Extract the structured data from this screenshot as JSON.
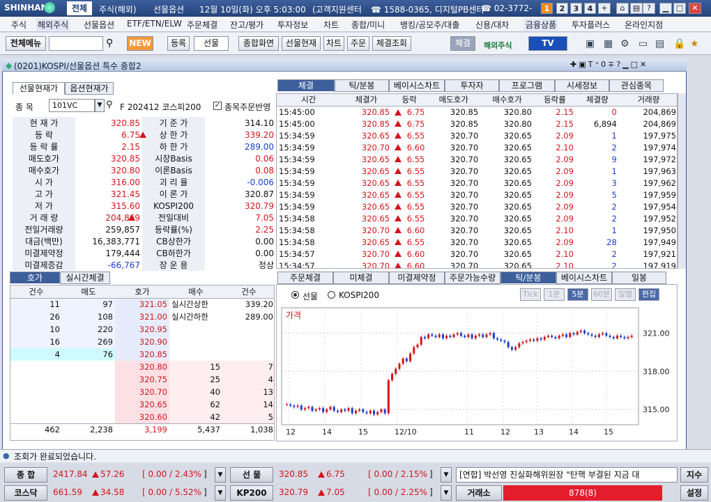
{
  "top": {
    "brand": "SHINHAN",
    "active_tab": "전체",
    "items": [
      "주식(해외)",
      "선물옵션",
      "12월 10일(화) 오후 5:03:00",
      "(고객지원센터",
      "☎ 1588-0365, 디지털PB센터",
      "☎ 02-3772-"
    ],
    "win_nums": [
      "1",
      "2",
      "3",
      "4"
    ]
  },
  "menu": [
    "주식",
    "해외주식",
    "선물옵션",
    "ETF/ETN/ELW",
    "주문체결",
    "잔고/평가",
    "투자정보",
    "차트",
    "종합/미니",
    "뱅킹/공모주/대출",
    "신용/대차",
    "금융상품",
    "투자플러스",
    "온라인지점"
  ],
  "toolbar": {
    "all_menu": "전체메뉴",
    "new": "NEW",
    "reg": "등록",
    "select": "선물",
    "buttons": [
      "종합화면",
      "선물현재",
      "차트",
      "주문",
      "체결조회"
    ],
    "cheg": "체결",
    "overseas": "해외주식",
    "tv": "TV"
  },
  "window": {
    "title": "(0201)KOSPI/선물옵션 특수 종합2"
  },
  "left": {
    "tabs": [
      "선물현재가",
      "옵션현재가"
    ],
    "code_label": "종 목",
    "code": "101VC",
    "name": "F 202412 코스피200",
    "checkbox": "종목주문반영",
    "rows": [
      [
        "현 재 가",
        "320.85",
        "기 준 가",
        "314.10"
      ],
      [
        "등 락",
        "6.75",
        "상 한 가",
        "339.20"
      ],
      [
        "등 락 률",
        "2.15",
        "하 한 가",
        "289.00"
      ],
      [
        "매도호가",
        "320.85",
        "시장Basis",
        "0.06"
      ],
      [
        "매수호가",
        "320.80",
        "이론Basis",
        "0.08"
      ],
      [
        "시 가",
        "316.00",
        "괴 리 율",
        "-0.006"
      ],
      [
        "고 가",
        "321.45",
        "이 론 가",
        "320.87"
      ],
      [
        "저 가",
        "315.60",
        "KOSPI200",
        "320.79"
      ],
      [
        "거 래 량",
        "204,869",
        "전일대비",
        "7.05"
      ],
      [
        "전일거래량",
        "259,857",
        "등락률(%)",
        "2.25"
      ],
      [
        "대금(백만)",
        "16,383,771",
        "CB상한가",
        "0.00"
      ],
      [
        "미결제약정",
        "179,444",
        "CB하한가",
        "0.00"
      ],
      [
        "미결제증감",
        "-66,767",
        "장 운 용",
        "정상"
      ]
    ]
  },
  "right_tabs": [
    "체결",
    "틱/분봉",
    "베이시스차트",
    "투자자",
    "프로그램",
    "시세정보",
    "관심종목"
  ],
  "ticks": {
    "headers": [
      "시간",
      "체결가",
      "등락",
      "매도호가",
      "매수호가",
      "등락률",
      "체결량",
      "거래량"
    ],
    "rows": [
      [
        "15:45:00",
        "320.85",
        "6.75",
        "320.85",
        "320.80",
        "2.15",
        "0",
        "204,869"
      ],
      [
        "15:45:00",
        "320.85",
        "6.75",
        "320.85",
        "320.80",
        "2.15",
        "6,894",
        "204,869"
      ],
      [
        "15:34:59",
        "320.65",
        "6.55",
        "320.70",
        "320.65",
        "2.09",
        "1",
        "197,975"
      ],
      [
        "15:34:59",
        "320.70",
        "6.60",
        "320.70",
        "320.65",
        "2.10",
        "2",
        "197,974"
      ],
      [
        "15:34:59",
        "320.65",
        "6.55",
        "320.70",
        "320.65",
        "2.09",
        "9",
        "197,972"
      ],
      [
        "15:34:59",
        "320.65",
        "6.55",
        "320.70",
        "320.65",
        "2.09",
        "1",
        "197,963"
      ],
      [
        "15:34:59",
        "320.65",
        "6.55",
        "320.70",
        "320.65",
        "2.09",
        "3",
        "197,962"
      ],
      [
        "15:34:59",
        "320.65",
        "6.55",
        "320.70",
        "320.65",
        "2.09",
        "5",
        "197,959"
      ],
      [
        "15:34:59",
        "320.65",
        "6.55",
        "320.70",
        "320.65",
        "2.09",
        "2",
        "197,954"
      ],
      [
        "15:34:58",
        "320.65",
        "6.55",
        "320.70",
        "320.65",
        "2.09",
        "2",
        "197,952"
      ],
      [
        "15:34:58",
        "320.70",
        "6.60",
        "320.70",
        "320.65",
        "2.10",
        "1",
        "197,950"
      ],
      [
        "15:34:58",
        "320.65",
        "6.55",
        "320.70",
        "320.65",
        "2.09",
        "28",
        "197,949"
      ],
      [
        "15:34:57",
        "320.70",
        "6.60",
        "320.70",
        "320.65",
        "2.10",
        "2",
        "197,921"
      ],
      [
        "15:34:57",
        "320.70",
        "6.60",
        "320.70",
        "320.65",
        "2.10",
        "2",
        "197,919"
      ]
    ]
  },
  "ob": {
    "tabs": [
      "호가",
      "실시간체결"
    ],
    "headers": [
      "건수",
      "매도",
      "호가",
      "매수",
      "건수"
    ],
    "asks": [
      [
        "11",
        "97",
        "321.05"
      ],
      [
        "26",
        "108",
        "321.00"
      ],
      [
        "10",
        "220",
        "320.95"
      ],
      [
        "16",
        "269",
        "320.90"
      ],
      [
        "4",
        "76",
        "320.85"
      ]
    ],
    "bids": [
      [
        "320.80",
        "15",
        "7"
      ],
      [
        "320.75",
        "25",
        "4"
      ],
      [
        "320.70",
        "40",
        "13"
      ],
      [
        "320.65",
        "62",
        "14"
      ],
      [
        "320.60",
        "42",
        "5"
      ]
    ],
    "limit_up_label": "실시간상한",
    "limit_up": "339.20",
    "limit_dn_label": "실시간하한",
    "limit_dn": "289.00",
    "totals": [
      "462",
      "2,238",
      "3,199",
      "5,437",
      "1,038"
    ]
  },
  "chart_tabs": [
    "주문체결",
    "미체결",
    "미결제약정",
    "주문가능수량",
    "틱/분봉",
    "베이시스차트",
    "일봉"
  ],
  "chart_opts": {
    "radio1": "선물",
    "radio2": "KOSPI200",
    "btns": [
      "Tick",
      "1분",
      "5분",
      "60분",
      "일별",
      "편집"
    ],
    "price_label": "가격"
  },
  "chart_data": {
    "type": "candlestick",
    "title": "가격",
    "y_ticks": [
      "321.00",
      "318.00",
      "315.00"
    ],
    "ylim": [
      313.8,
      323.0
    ],
    "x_ticks": [
      "12",
      "14",
      "15",
      "12/10",
      "11",
      "12",
      "13",
      "14",
      "15"
    ],
    "closes": [
      315.4,
      315.3,
      315.2,
      315.3,
      315.0,
      315.1,
      315.2,
      314.9,
      315.0,
      315.1,
      314.8,
      315.0,
      315.2,
      314.9,
      314.8,
      315.0,
      314.9,
      315.1,
      314.7,
      314.9,
      315.0,
      314.8,
      314.7,
      314.9,
      314.6,
      314.8,
      315.0,
      314.7,
      317.3,
      317.8,
      318.2,
      318.6,
      319.0,
      318.8,
      319.4,
      319.9,
      320.1,
      320.7,
      320.6,
      320.9,
      320.8,
      320.7,
      320.9,
      320.6,
      320.8,
      320.7,
      320.9,
      321.0,
      320.8,
      320.7,
      320.9,
      320.6,
      320.8,
      320.9,
      320.7,
      320.9,
      321.0,
      320.6,
      320.5,
      320.4,
      320.3,
      319.9,
      319.7,
      319.9,
      320.2,
      320.3,
      320.4,
      320.5,
      320.4,
      320.6,
      320.5,
      320.7,
      320.8,
      320.7,
      320.6,
      320.8,
      320.9,
      320.7,
      321.0,
      320.9,
      321.1,
      321.2,
      321.0,
      320.9,
      320.8,
      320.7,
      320.9,
      321.0,
      320.8,
      320.7,
      320.6,
      320.8,
      320.7,
      320.6,
      320.7,
      320.8
    ]
  },
  "status": "조회가 완료되었습니다.",
  "bottom": {
    "r1": [
      [
        "종 합",
        "2417.84",
        "57.26",
        "[ 0.00 / 2.43%",
        "]"
      ],
      [
        "선 물",
        "320.85",
        "6.75",
        "[ 0.00 / 2.15%",
        "]"
      ]
    ],
    "r2": [
      [
        "코스닥",
        "661.59",
        "34.58",
        "[ 0.00 / 5.52%",
        "]"
      ],
      [
        "KP200",
        "320.79",
        "7.05",
        "[ 0.00 / 2.25%",
        "]"
      ]
    ],
    "news": "[연합] 박선영 진실화해위원장 \"탄핵 부결된 지금 대",
    "index_btn": "지수",
    "exchange": "거래소",
    "exchange_val": "878(8)",
    "settings": "설정"
  },
  "colors": {
    "up": "#d4141b",
    "down": "#1a3fd0"
  }
}
